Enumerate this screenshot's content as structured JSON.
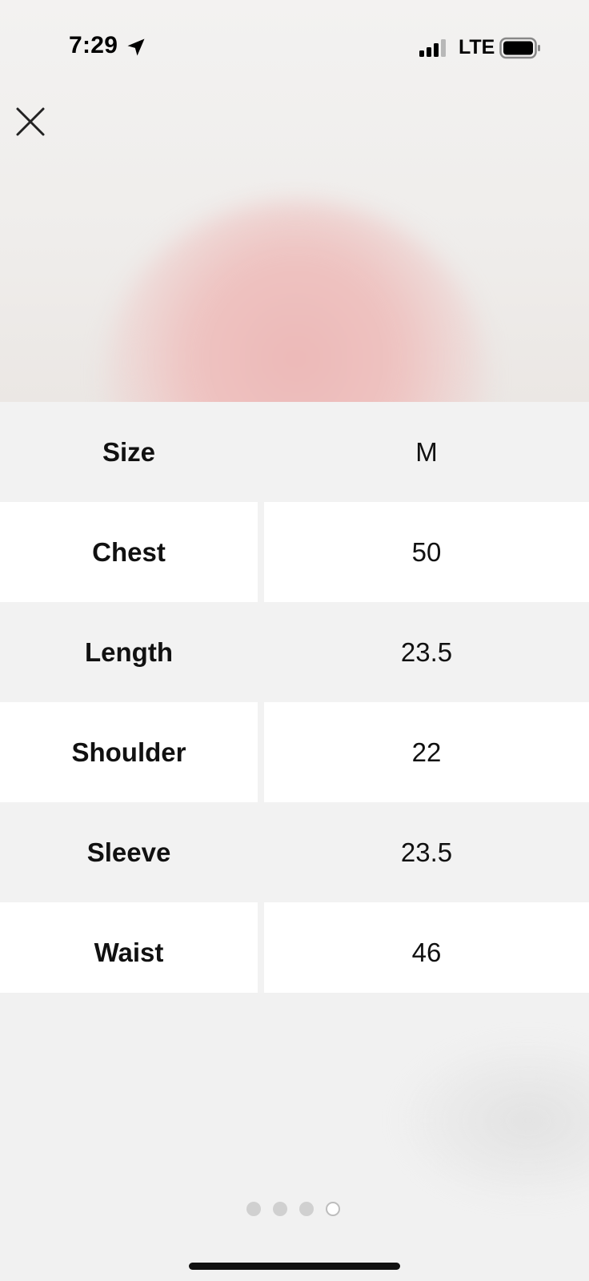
{
  "status_bar": {
    "time": "7:29",
    "network": "LTE",
    "icons": [
      "location-arrow-icon",
      "signal-icon",
      "battery-icon"
    ]
  },
  "toolbar": {
    "close_icon": "close-icon"
  },
  "size_chart": {
    "rows": [
      {
        "label": "Size",
        "value": "M"
      },
      {
        "label": "Chest",
        "value": "50"
      },
      {
        "label": "Length",
        "value": "23.5"
      },
      {
        "label": "Shoulder",
        "value": "22"
      },
      {
        "label": "Sleeve",
        "value": "23.5"
      },
      {
        "label": "Waist",
        "value": "46"
      }
    ]
  },
  "pager": {
    "count": 4,
    "active_index": 3
  },
  "colors": {
    "shaded_row": "#f2f2f2",
    "white_row": "#ffffff",
    "blush_accent": "#edb9b8"
  }
}
